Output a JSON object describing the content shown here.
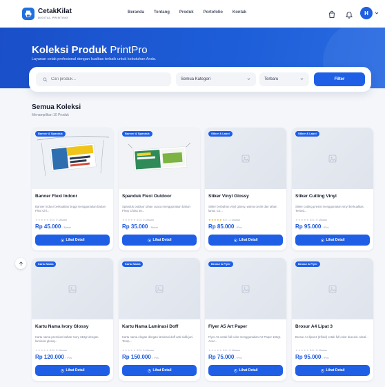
{
  "brand": {
    "name": "CetakKilat",
    "tagline": "DIGITAL PRINTING"
  },
  "nav": {
    "links": [
      "Beranda",
      "Tentang",
      "Produk",
      "Portofolio",
      "Kontak"
    ],
    "avatar_initial": "H"
  },
  "hero": {
    "title_bold": "Koleksi Produk",
    "title_light": "PrintPro",
    "subtitle": "Layanan cetak profesional dengan kualitas terbaik untuk kebutuhan Anda."
  },
  "filter": {
    "search_placeholder": "Cari produk...",
    "category_value": "Semua Kategori",
    "sort_value": "Terbaru",
    "button_label": "Filter"
  },
  "section": {
    "title": "Semua Koleksi",
    "subtitle": "Menampilkan 10 Produk"
  },
  "cta_label": "Lihat Detail",
  "products": [
    {
      "badge": "Banner & Spanduk",
      "name": "Banner Flexi Indoor",
      "desc": "Banner indoor berkualitas tinggi menggunakan bahan Flexi Chi...",
      "rating": "0.0 • 0 Ulasan",
      "price": "Rp 45.000",
      "unit": "/ Meter",
      "image": "banner"
    },
    {
      "badge": "Banner & Spanduk",
      "name": "Spanduk Flexi Outdoor",
      "desc": "Spanduk outdoor tahan cuaca menggunakan bahan Flexy China 28...",
      "rating": "0.0 • 0 Ulasan",
      "price": "Rp 35.000",
      "unit": "/ Meter",
      "image": "spanduk"
    },
    {
      "badge": "Stiker & Label",
      "name": "Stiker Vinyl Glossy",
      "desc": "Stiker berbahan vinyl glossy, warna cerah dan tahan lama. Co...",
      "rating": "5.0 • 1 Ulasan",
      "price": "Rp 85.000",
      "unit": "/ Pcs",
      "image": "placeholder",
      "gold": true
    },
    {
      "badge": "Stiker & Label",
      "name": "Stiker Cutting Vinyl",
      "desc": "Stiker cutting presisi menggunakan vinyl berkualitas. Tersed...",
      "rating": "0.0 • 0 Ulasan",
      "price": "Rp 95.000",
      "unit": "/ Pcs",
      "image": "placeholder"
    },
    {
      "badge": "Kartu Nama",
      "name": "Kartu Nama Ivory Glossy",
      "desc": "Kartu nama premium bahan Ivory 310gr dengan laminasi glossy...",
      "rating": "0.0 • 0 Ulasan",
      "price": "Rp 120.000",
      "unit": "/ Pcs",
      "image": "placeholder"
    },
    {
      "badge": "Kartu Nama",
      "name": "Kartu Nama Laminasi Doff",
      "desc": "Kartu nama elegan dengan laminasi doff anti sidik jari. Temp...",
      "rating": "0.0 • 0 Ulasan",
      "price": "Rp 150.000",
      "unit": "/ Pcs",
      "image": "placeholder"
    },
    {
      "badge": "Brosur & Flyer",
      "name": "Flyer A5 Art Paper",
      "desc": "Flyer A5 cetak full color menggunakan Art Paper 150gr. Acoc...",
      "rating": "0.0 • 0 Ulasan",
      "price": "Rp 75.000",
      "unit": "/ Pcs",
      "image": "placeholder"
    },
    {
      "badge": "Brosur & Flyer",
      "name": "Brosur A4 Lipat 3",
      "desc": "Brosur A4 lipat 3 (trifold) cetak full color dua sisi. Ideal...",
      "rating": "0.0 • 0 Ulasan",
      "price": "Rp 95.000",
      "unit": "/ Pcs",
      "image": "placeholder"
    }
  ],
  "colors": {
    "primary": "#1f5fe6",
    "hero": "#1a4fc9",
    "price": "#1a56db",
    "background": "#f4f6fa"
  }
}
